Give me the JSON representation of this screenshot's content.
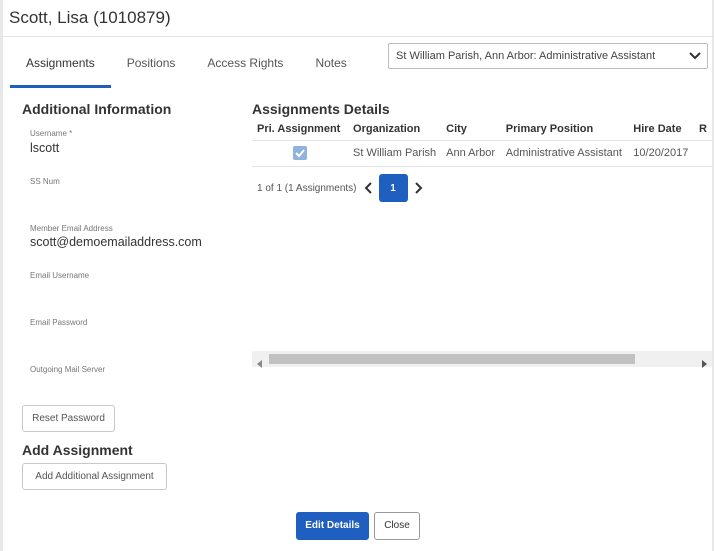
{
  "window": {
    "title": "Scott, Lisa (1010879)"
  },
  "tabs": [
    {
      "label": "Assignments",
      "active": true
    },
    {
      "label": "Positions",
      "active": false
    },
    {
      "label": "Access Rights",
      "active": false
    },
    {
      "label": "Notes",
      "active": false
    }
  ],
  "org_select": {
    "value": "St William Parish, Ann Arbor: Administrative Assistant",
    "icon": "chevron-down-icon"
  },
  "additional_info": {
    "title": "Additional Information",
    "username_label": "Username *",
    "username_value": "lscott",
    "ss_label": "SS Num",
    "ss_value": "",
    "email_label": "Member Email Address",
    "email_value": "scott@demoemailaddress.com",
    "email_username_label": "Email Username",
    "email_password_label": "Email Password",
    "mail_server_label": "Outgoing Mail Server",
    "reset_password_label": "Reset Password"
  },
  "add_assignment": {
    "title": "Add Assignment",
    "button_label": "Add Additional Assignment"
  },
  "assignments": {
    "title": "Assignments Details",
    "columns": [
      "Pri. Assignment",
      "Organization",
      "City",
      "Primary Position",
      "Hire Date",
      "R"
    ],
    "rows": [
      {
        "primary": true,
        "organization": "St William Parish",
        "city": "Ann Arbor",
        "position": "Administrative Assistant",
        "hire_date": "10/20/2017",
        "extra": ""
      }
    ],
    "pager_text": "1 of 1 (1 Assignments)",
    "current_page": "1"
  },
  "footer": {
    "edit_label": "Edit Details",
    "close_label": "Close"
  },
  "colors": {
    "accent": "#1f5fbf",
    "checkbox": "#8fb2e0"
  }
}
